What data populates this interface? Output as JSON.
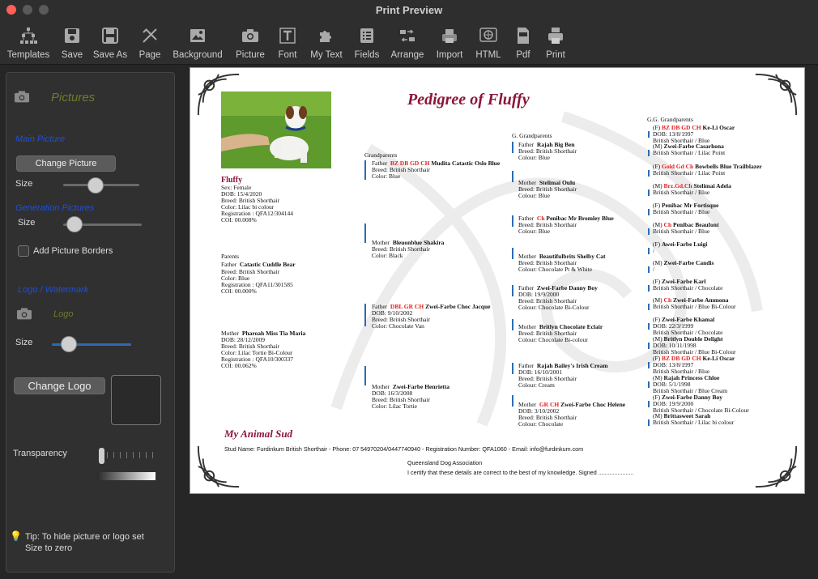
{
  "window": {
    "title": "Print Preview"
  },
  "toolbar": [
    {
      "label": "Templates",
      "icon": "templates-icon"
    },
    {
      "label": "Save",
      "icon": "save-icon"
    },
    {
      "label": "Save As",
      "icon": "save-as-icon"
    },
    {
      "label": "Page",
      "icon": "page-icon"
    },
    {
      "label": "Background",
      "icon": "background-icon"
    },
    {
      "label": "Picture",
      "icon": "camera-icon"
    },
    {
      "label": "Font",
      "icon": "font-icon"
    },
    {
      "label": "My Text",
      "icon": "puzzle-icon"
    },
    {
      "label": "Fields",
      "icon": "fields-icon"
    },
    {
      "label": "Arrange",
      "icon": "arrange-icon"
    },
    {
      "label": "Import",
      "icon": "import-icon"
    },
    {
      "label": "HTML",
      "icon": "html-icon"
    },
    {
      "label": "Pdf",
      "icon": "pdf-icon"
    },
    {
      "label": "Print",
      "icon": "print-icon"
    }
  ],
  "sidebar": {
    "header": "Pictures",
    "main_picture": "Main Picture",
    "change_picture": "Change Picture",
    "size": "Size",
    "generation_pictures": "Generation Pictures",
    "add_borders": "Add Picture Borders",
    "logo_watermark": "Logo / Watermark",
    "logo": "Logo",
    "change_logo": "Change Logo",
    "transparency": "Transparency",
    "tip": "Tip: To hide picture or logo set Size to zero",
    "main_size": 0.4,
    "gen_size": 0.05,
    "logo_size": 0.14,
    "transparency_value": 0.0
  },
  "pedigree": {
    "title": "Pedigree of  Fluffy",
    "subject": {
      "name": "Fluffy",
      "sex": "Sex: Female",
      "dob": "DOB: 15/4/2020",
      "breed": "Breed: British Shorthair",
      "color": "Color: Lilac bi colour",
      "registration": "Registration : QFA12/304144",
      "coi": "COI: 00.008%"
    },
    "parents": {
      "heading": "Parents",
      "father": {
        "role": "Father",
        "name": "Catastic Cuddle Bear",
        "breed": "Breed: British Shorthair",
        "color": "Color: Blue",
        "registration": "Registration : QFA11/301585",
        "coi": "COI: 00.000%"
      },
      "mother": {
        "role": "Mother",
        "name": "Pharoah Miss Tia Maria",
        "dob": "DOB: 28/12/2009",
        "breed": "Breed: British Shorthair",
        "color": "Color: Lilac Tortie Bi-Colour",
        "registration": "Registration : QFA10/300337",
        "coi": "COI: 00.062%"
      }
    },
    "grandparents": {
      "heading": "Grandparents",
      "gp1": {
        "role": "Father",
        "title": "BZ DB GD CH",
        "name": "Mudita Catastic Oslo Blue",
        "breed": "Breed: British Shorthair",
        "color": "Color: Blue"
      },
      "gp2": {
        "role": "Mother",
        "name": "Bleuonblue Shakira",
        "breed": "Breed: British Shorthair",
        "color": "Color: Black"
      },
      "gp3": {
        "role": "Father",
        "title": "DBL GR CH",
        "name": "Zwei-Farbe Choc Jacque",
        "dob": "DOB: 9/10/2002",
        "breed": "Breed: British Shorthair",
        "color": "Color: Chocolate Van"
      },
      "gp4": {
        "role": "Mother",
        "name": "Zwei-Farbe Henrietta",
        "dob": "DOB: 16/3/2008",
        "breed": "Breed: British Shorthair",
        "color": "Color: Lilac Tortie"
      }
    },
    "g_grandparents": {
      "heading": "G. Grandparents",
      "ggp1": {
        "role": "Father",
        "name": "Rajah Big Ben",
        "breed": "Breed: British Shorthair",
        "color": "Colour: Blue"
      },
      "ggp2": {
        "role": "Mother",
        "name": "Stelimai Oulu",
        "breed": "Breed: British Shorthair",
        "color": "Colour: Blue"
      },
      "ggp3": {
        "role": "Father",
        "title": "Ch",
        "name": "Penibac Mr Bromley Blue",
        "breed": "Breed: British Shorthair",
        "color": "Colour: Blue"
      },
      "ggp4": {
        "role": "Mother",
        "name": "Beautifulbrits Shelby Cat",
        "breed": "Breed: British Shorthair",
        "color": "Colour: Chocolate Pt & White"
      },
      "ggp5": {
        "role": "Father",
        "name": "Zwei-Farbe Danny Boy",
        "dob": "DOB: 19/9/2000",
        "breed": "Breed: British Shorthair",
        "color": "Colour: Chocolate Bi-Colour"
      },
      "ggp6": {
        "role": "Mother",
        "name": "Britlyn Chocolate Eclair",
        "breed": "Breed: British Shorthair",
        "color": "Colour: Chocolate Bi-colour"
      },
      "ggp7": {
        "role": "Father",
        "name": "Rajah Bailey's Irish Cream",
        "dob": "DOB: 16/10/2001",
        "breed": "Breed: British Shorthair",
        "color": "Colour: Cream"
      },
      "ggp8": {
        "role": "Mother",
        "title": "GR CH",
        "name": "Zwei-Farbe Choc Helene",
        "dob": "DOB: 3/10/2002",
        "breed": "Breed: British Shorthair",
        "color": "Colour: Chocolate"
      }
    },
    "gg_grandparents": {
      "heading": "G.G. Grandparents",
      "items": [
        {
          "role": "(F)",
          "title": "BZ DB GD CH",
          "name": "Ke-Li Oscar",
          "line2": "DOB: 13/8/1997",
          "line3": "British Shorthair / Blue"
        },
        {
          "role": "(M)",
          "title": "",
          "name": "Zwei-Farbe Casarhona",
          "line2": "British Shorthair / Lilac Point",
          "line3": ""
        },
        {
          "role": "(F)",
          "title": "Gold Gd Ch",
          "name": "Bowbells Blue Trailblazer",
          "line2": "British Shorthair / Lilac Point",
          "line3": ""
        },
        {
          "role": "(M)",
          "title": "Brz.Gd.Ch",
          "name": "Stelimai Adela",
          "line2": "British Shorthair / Blue",
          "line3": ""
        },
        {
          "role": "(F)",
          "title": "",
          "name": "Penibac Mr Fortisque",
          "line2": "British Shorthair / Blue",
          "line3": ""
        },
        {
          "role": "(M)",
          "title": "Ch",
          "name": "Penibac Beaufont",
          "line2": "British Shorthair / Blue",
          "line3": ""
        },
        {
          "role": "(F)",
          "title": "",
          "name": "Awei-Farbe Luigi",
          "line2": "/",
          "line3": ""
        },
        {
          "role": "(M)",
          "title": "",
          "name": "Zwei-Farbe Candis",
          "line2": "/",
          "line3": ""
        },
        {
          "role": "(F)",
          "title": "",
          "name": "Zwei-Farbe Karl",
          "line2": "British Shorthair / Chocolate",
          "line3": ""
        },
        {
          "role": "(M)",
          "title": "Ch",
          "name": "Zwei-Farbe Ammona",
          "line2": "British Shorthair / Blue Bi-Colour",
          "line3": ""
        },
        {
          "role": "(F)",
          "title": "",
          "name": "Zwei-Farbe Khamal",
          "line2": "DOB: 22/3/1999",
          "line3": "British Shorthair / Chocolate"
        },
        {
          "role": "(M)",
          "title": "",
          "name": "Britlyn Double Delight",
          "line2": "DOB: 10/11/1998",
          "line3": "British Shorthair / Blue Bi-Colour"
        },
        {
          "role": "(F)",
          "title": "BZ DB GD CH",
          "name": "Ke-Li Oscar",
          "line2": "DOB: 13/8/1997",
          "line3": "British Shorthair / Blue"
        },
        {
          "role": "(M)",
          "title": "",
          "name": "Rajah Princess Chloe",
          "line2": "DOB: 5/1/1998",
          "line3": "British Shorthair / Blue Cream"
        },
        {
          "role": "(F)",
          "title": "",
          "name": "Zwei-Farbe Danny Boy",
          "line2": "DOB: 19/9/2000",
          "line3": "British Shorthair / Chocolate Bi-Colour"
        },
        {
          "role": "(M)",
          "title": "",
          "name": "Brittasweet Sarah",
          "line2": "British Shorthair / Lilac bi colour",
          "line3": ""
        }
      ]
    },
    "footer": {
      "stud_title": "My Animal Sud",
      "stud_line": "Stud Name: Furdinkum British Shorthair - Phone: 07 54970204/0447740940 - Registration Number: QFA1060 - Email: info@furdinkum.com",
      "association": "Queensland Dog Association",
      "certify": "I certify that these details are correct to the best of my knowledge. Signed ......................"
    }
  },
  "colors": {
    "accent_blue": "#1f4fd6",
    "title_maroon": "#8b1538",
    "red_title": "#e02020",
    "olive": "#6c7d2c"
  }
}
